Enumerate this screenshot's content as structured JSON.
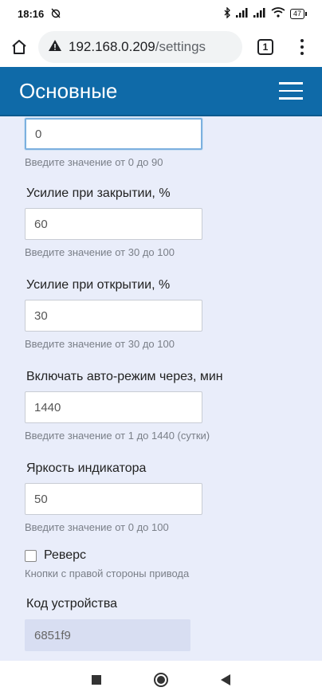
{
  "status_bar": {
    "time": "18:16",
    "battery": "47",
    "icons": [
      "alarm-off-icon",
      "bluetooth-icon",
      "signal-icon",
      "signal-icon",
      "wifi-icon",
      "battery-icon"
    ]
  },
  "browser": {
    "url_host": "192.168.0.209",
    "url_path": "/settings",
    "tab_count": "1"
  },
  "header": {
    "title": "Основные"
  },
  "form": {
    "first": {
      "value": "0",
      "hint": "Введите значение от 0 до 90"
    },
    "close_force": {
      "label": "Усилие при закрытии, %",
      "value": "60",
      "hint": "Введите значение от 30 до 100"
    },
    "open_force": {
      "label": "Усилие при открытии, %",
      "value": "30",
      "hint": "Введите значение от 30 до 100"
    },
    "auto_mode": {
      "label": "Включать авто-режим через, мин",
      "value": "1440",
      "hint": "Введите значение от 1 до 1440 (сутки)"
    },
    "brightness": {
      "label": "Яркость индикатора",
      "value": "50",
      "hint": "Введите значение от 0 до 100"
    },
    "reverse": {
      "label": "Реверс",
      "hint": "Кнопки с правой стороны привода",
      "checked": false
    },
    "device_code": {
      "label": "Код устройства",
      "value": "6851f9"
    }
  },
  "colors": {
    "header_bg": "#0f6aa8",
    "content_bg": "#e9edfa",
    "code_bg": "#d8def2"
  }
}
